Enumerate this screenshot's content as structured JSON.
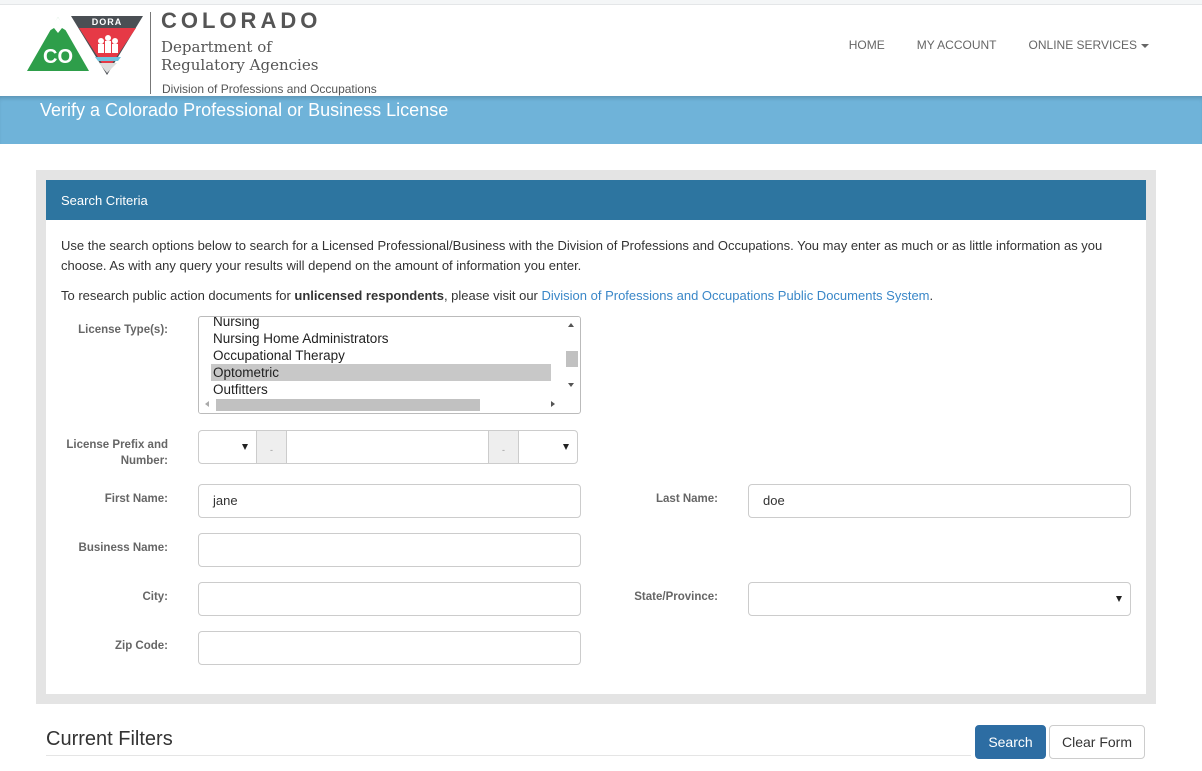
{
  "header": {
    "logo_alt": "CO DORA logo",
    "logo_text_co": "CO",
    "logo_text_dora": "DORA",
    "brand_title": "COLORADO",
    "brand_dept_line1": "Department of",
    "brand_dept_line2": "Regulatory Agencies",
    "brand_division": "Division of Professions and Occupations",
    "nav": [
      {
        "label": "HOME"
      },
      {
        "label": "MY ACCOUNT"
      },
      {
        "label": "ONLINE SERVICES",
        "has_dropdown": true
      }
    ]
  },
  "banner": {
    "title": "Verify a Colorado Professional or Business License"
  },
  "panel": {
    "heading": "Search Criteria",
    "intro_text": "Use the search options below to search for a Licensed Professional/Business with the Division of Professions and Occupations. You may enter as much or as little information as you choose. As with any query your results will depend on the amount of information you enter.",
    "research_prefix": "To research public action documents for ",
    "research_bold": "unlicensed respondents",
    "research_middle": ", please visit our ",
    "research_link": "Division of Professions and Occupations Public Documents System",
    "research_suffix": "."
  },
  "form": {
    "license_types": {
      "label": "License Type(s):",
      "options": [
        "Nursing",
        "Nursing Home Administrators",
        "Occupational Therapy",
        "Optometric",
        "Outfitters"
      ],
      "selected": "Optometric"
    },
    "license_prefix": {
      "label_line1": "License Prefix and",
      "label_line2": "Number:",
      "prefix_value": "",
      "separator1": "-",
      "number_value": "",
      "separator2": "-",
      "suffix_value": ""
    },
    "first_name": {
      "label": "First Name:",
      "value": "jane"
    },
    "last_name": {
      "label": "Last Name:",
      "value": "doe"
    },
    "business_name": {
      "label": "Business Name:",
      "value": ""
    },
    "city": {
      "label": "City:",
      "value": ""
    },
    "state": {
      "label": "State/Province:",
      "value": ""
    },
    "zip": {
      "label": "Zip Code:",
      "value": ""
    }
  },
  "footer": {
    "filters_heading": "Current Filters",
    "search_button": "Search",
    "clear_button": "Clear Form"
  },
  "colors": {
    "banner": "#6fb3d9",
    "panel_header": "#2d75a0",
    "primary_button": "#2d6da3",
    "link": "#3a87c8"
  }
}
